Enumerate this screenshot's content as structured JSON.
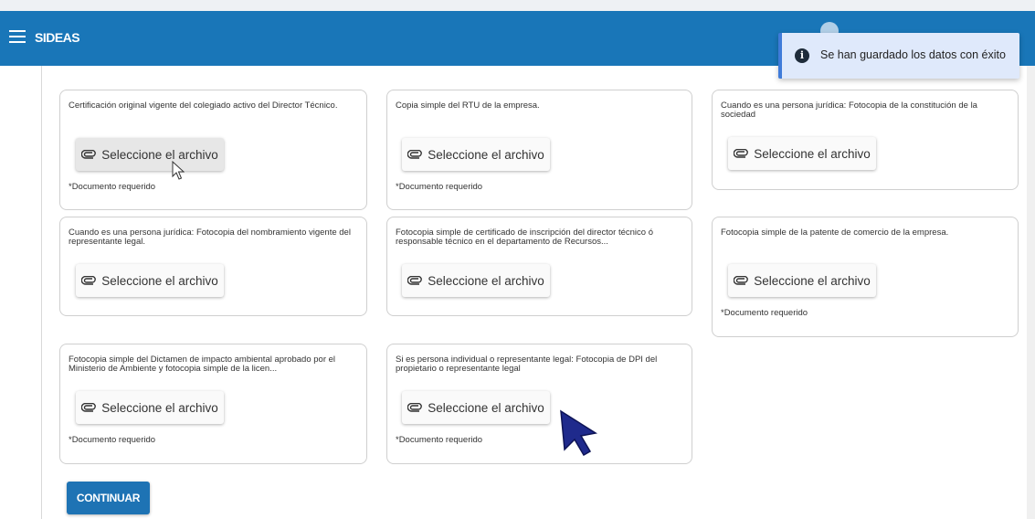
{
  "app": {
    "title": "SIDEAS"
  },
  "notification": {
    "icon": "info-icon",
    "text": "Se han guardado los datos con éxito"
  },
  "documents": [
    {
      "title": "Certificación original vigente del colegiado activo del Director Técnico.",
      "button": "Seleccione el archivo",
      "required": "*Documento requerido"
    },
    {
      "title": "Copia simple del RTU de la empresa.",
      "button": "Seleccione el archivo",
      "required": "*Documento requerido"
    },
    {
      "title": "Cuando es una persona jurídica: Fotocopia de la constitución de la sociedad",
      "button": "Seleccione el archivo",
      "required": ""
    },
    {
      "title": "Cuando es una persona jurídica: Fotocopia del nombramiento vigente del representante legal.",
      "button": "Seleccione el archivo",
      "required": ""
    },
    {
      "title": "Fotocopia simple de certificado de inscripción del director técnico ó responsable técnico en el departamento de Recursos...",
      "button": "Seleccione el archivo",
      "required": ""
    },
    {
      "title": "Fotocopia simple de la patente de comercio de la empresa.",
      "button": "Seleccione el archivo",
      "required": "*Documento requerido"
    },
    {
      "title": "Fotocopia simple del Dictamen de impacto ambiental aprobado por el Ministerio de Ambiente y fotocopia simple de la licen...",
      "button": "Seleccione el archivo",
      "required": "*Documento requerido"
    },
    {
      "title": "Si es persona individual o representante legal: Fotocopia de DPI del propietario o representante legal",
      "button": "Seleccione el archivo",
      "required": "*Documento requerido"
    }
  ],
  "actions": {
    "continue": "CONTINUAR"
  },
  "colors": {
    "header": "#1976b8",
    "primary_button": "#1e73b4",
    "toast_background": "#dfe9fb",
    "toast_accent": "#3f7bd9"
  }
}
